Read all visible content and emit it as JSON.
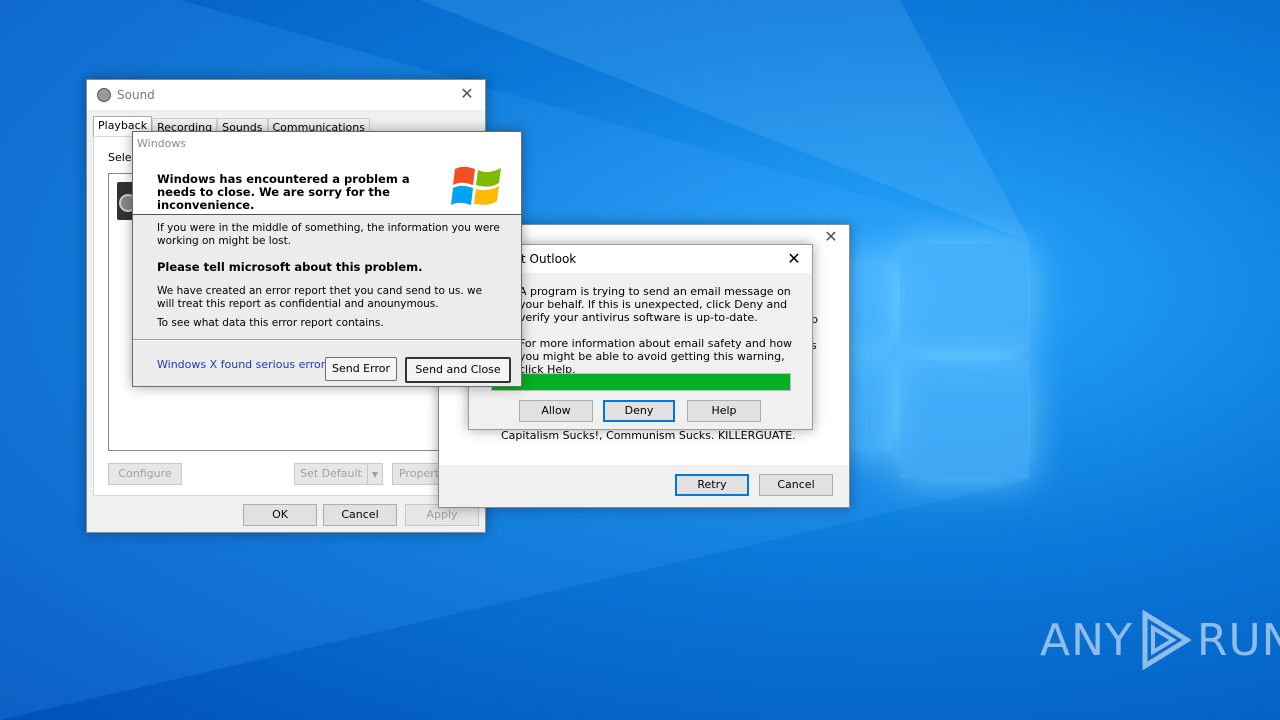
{
  "sound_window": {
    "title": "Sound",
    "tabs": [
      "Playback",
      "Recording",
      "Sounds",
      "Communications"
    ],
    "select_label": "Selec",
    "buttons": {
      "configure": "Configure",
      "set_default": "Set Default",
      "properties": "Propert",
      "ok": "OK",
      "cancel": "Cancel",
      "apply": "Apply"
    }
  },
  "error_dialog": {
    "title": "Windows",
    "headline": "Windows has encountered a problem a needs to close. We are sorry for the inconvenience.",
    "para1": "If you were in the middle of something, the information you were working on might be lost.",
    "para2": "Please tell microsoft about this problem.",
    "para3": "We have created an error report thet you cand send to us. we will treat this report as confidential and anounymous.",
    "para4": "To see what data this error report contains.",
    "footer_text": "Windows X found serious error.",
    "send_error": "Send Error",
    "send_close": "Send and Close"
  },
  "retry_window": {
    "caption": "Capitalism Sucks!, Communism Sucks. KILLERGUATE.",
    "side_p": "p",
    "side_s": "s",
    "retry": "Retry",
    "cancel": "Cancel"
  },
  "outlook_dialog": {
    "title": "ft Outlook",
    "message1": "A program is trying to send an email message on your behalf. If this is unexpected, click Deny and verify your antivirus software is up-to-date.",
    "message2": "For more information about email safety and how you might be able to avoid getting this warning, click Help.",
    "progress": 1.0,
    "allow": "Allow",
    "deny": "Deny",
    "help": "Help"
  },
  "watermark": {
    "left": "ANY",
    "right": "RUN"
  },
  "colors": {
    "desktop": "#0a78d8",
    "progress": "#06b025",
    "link": "#1c3bb8"
  }
}
